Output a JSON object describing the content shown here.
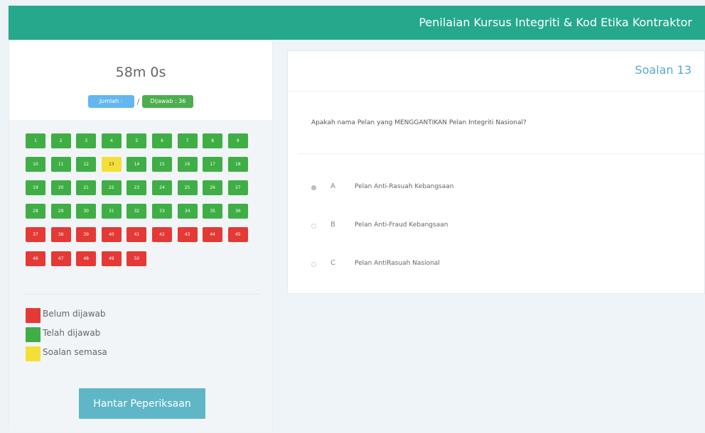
{
  "header": {
    "title": "Penilaian Kursus Integriti & Kod Etika Kontraktor",
    "color": "#26a88d"
  },
  "sidebar": {
    "timer": "58m 0s",
    "total_badge": "Jumlah : 50",
    "answered_badge": "Dijawab : 36",
    "separator": "/",
    "submit_label": "Hantar Peperiksaan",
    "legend": [
      {
        "label": "Belum dijawab",
        "color": "#e53935"
      },
      {
        "label": "Telah dijawab",
        "color": "#3fae45"
      },
      {
        "label": "Soalan semasa",
        "color": "#f4df38"
      }
    ],
    "questions": [
      {
        "n": "1",
        "state": "answered"
      },
      {
        "n": "2",
        "state": "answered"
      },
      {
        "n": "3",
        "state": "answered"
      },
      {
        "n": "4",
        "state": "answered"
      },
      {
        "n": "5",
        "state": "answered"
      },
      {
        "n": "6",
        "state": "answered"
      },
      {
        "n": "7",
        "state": "answered"
      },
      {
        "n": "8",
        "state": "answered"
      },
      {
        "n": "9",
        "state": "answered"
      },
      {
        "n": "10",
        "state": "answered"
      },
      {
        "n": "11",
        "state": "answered"
      },
      {
        "n": "12",
        "state": "answered"
      },
      {
        "n": "13",
        "state": "current"
      },
      {
        "n": "14",
        "state": "answered"
      },
      {
        "n": "15",
        "state": "answered"
      },
      {
        "n": "16",
        "state": "answered"
      },
      {
        "n": "17",
        "state": "answered"
      },
      {
        "n": "18",
        "state": "answered"
      },
      {
        "n": "19",
        "state": "answered"
      },
      {
        "n": "20",
        "state": "answered"
      },
      {
        "n": "21",
        "state": "answered"
      },
      {
        "n": "22",
        "state": "answered"
      },
      {
        "n": "23",
        "state": "answered"
      },
      {
        "n": "24",
        "state": "answered"
      },
      {
        "n": "25",
        "state": "answered"
      },
      {
        "n": "26",
        "state": "answered"
      },
      {
        "n": "27",
        "state": "answered"
      },
      {
        "n": "28",
        "state": "answered"
      },
      {
        "n": "29",
        "state": "answered"
      },
      {
        "n": "30",
        "state": "answered"
      },
      {
        "n": "31",
        "state": "answered"
      },
      {
        "n": "32",
        "state": "answered"
      },
      {
        "n": "33",
        "state": "answered"
      },
      {
        "n": "34",
        "state": "answered"
      },
      {
        "n": "35",
        "state": "answered"
      },
      {
        "n": "36",
        "state": "answered"
      },
      {
        "n": "37",
        "state": "unanswered"
      },
      {
        "n": "38",
        "state": "unanswered"
      },
      {
        "n": "39",
        "state": "unanswered"
      },
      {
        "n": "40",
        "state": "unanswered"
      },
      {
        "n": "41",
        "state": "unanswered"
      },
      {
        "n": "42",
        "state": "unanswered"
      },
      {
        "n": "43",
        "state": "unanswered"
      },
      {
        "n": "44",
        "state": "unanswered"
      },
      {
        "n": "45",
        "state": "unanswered"
      },
      {
        "n": "46",
        "state": "unanswered"
      },
      {
        "n": "47",
        "state": "unanswered"
      },
      {
        "n": "48",
        "state": "unanswered"
      },
      {
        "n": "49",
        "state": "unanswered"
      },
      {
        "n": "50",
        "state": "unanswered"
      }
    ]
  },
  "question": {
    "number_label": "Soalan 13",
    "text": "Apakah nama Pelan yang MENGGANTIKAN Pelan Integriti Nasional?",
    "options": [
      {
        "letter": "A",
        "text": "Pelan Anti-Rasuah Kebangsaan",
        "selected": true
      },
      {
        "letter": "B",
        "text": "Pelan Anti-Fraud Kebangsaan",
        "selected": false
      },
      {
        "letter": "C",
        "text": "Pelan AntiRasuah Nasional",
        "selected": false
      }
    ]
  }
}
